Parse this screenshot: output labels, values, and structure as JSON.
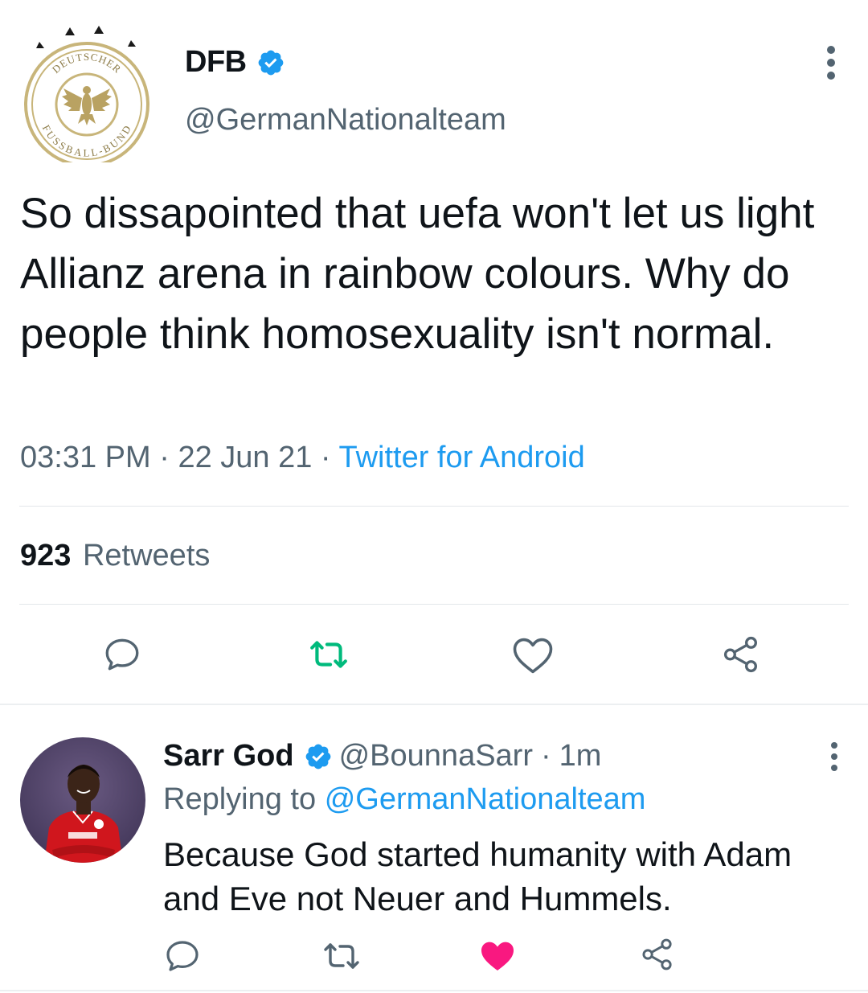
{
  "main_tweet": {
    "display_name": "DFB",
    "handle": "@GermanNationalteam",
    "text": "So dissapointed that uefa won't let us light Allianz arena in rainbow colours. Why do people think homosexuality isn't normal.",
    "time": "03:31 PM",
    "date": "22 Jun 21",
    "separator": "·",
    "source": "Twitter for Android",
    "retweet_count": "923",
    "retweet_label": "Retweets",
    "logo_text_top": "DEUTSCHER",
    "logo_text_bottom": "FUSSBALL-BUND"
  },
  "reply": {
    "display_name": "Sarr God",
    "handle": "@BounnaSarr",
    "separator": "·",
    "time": "1m",
    "replying_label": "Replying to",
    "replying_to": "@GermanNationalteam",
    "text": "Because God started humanity with Adam and Eve not Neuer and Hummels.",
    "liked": true
  },
  "icons": {
    "verified": "verified-badge-icon",
    "reply": "reply-icon",
    "retweet": "retweet-icon",
    "like": "like-icon",
    "share": "share-icon",
    "more": "more-options-icon"
  },
  "colors": {
    "accent": "#1d9bf0",
    "retweet_active": "#00ba7c",
    "like_active": "#f91880",
    "secondary_text": "#536471"
  }
}
